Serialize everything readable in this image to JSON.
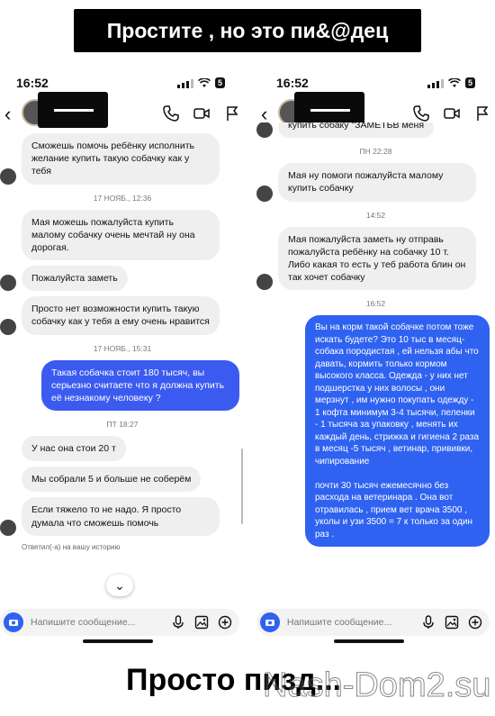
{
  "banner": {
    "text": "Простите , но это пи&@дец"
  },
  "caption": {
    "text": "Просто пизд..."
  },
  "watermark": {
    "text": "Nash-Dom2.su"
  },
  "left": {
    "status": {
      "time": "16:52",
      "battery": "5"
    },
    "messages": [
      {
        "type": "in",
        "text": "Сможешь помочь ребёнку исполнить желание купить такую собачку как у тебя"
      },
      {
        "type": "ts",
        "text": "17 НОЯБ., 12:36"
      },
      {
        "type": "in",
        "text": "Мая можешь пожалуйста купить малому собачку очень мечтай ну она дорогая."
      },
      {
        "type": "in",
        "text": "Пожалуйста заметь"
      },
      {
        "type": "in",
        "text": "Просто нет возможности купить такую собачку как у тебя а ему очень нравится"
      },
      {
        "type": "ts",
        "text": "17 НОЯБ., 15:31"
      },
      {
        "type": "out",
        "text": "Такая собачка стоит 180 тысяч, вы серьезно считаете что я должна купить её незнакому человеку ?"
      },
      {
        "type": "ts",
        "text": "ПТ 18:27"
      },
      {
        "type": "in",
        "text": "У нас она стои 20 т"
      },
      {
        "type": "in",
        "text": "Мы собрали 5 и больше не соберём"
      },
      {
        "type": "in",
        "text": "Если тяжело то не надо. Я просто думала что сможешь помочь"
      }
    ],
    "reply_note": "Ответил(-а) на вашу историю",
    "composer_placeholder": "Напишите сообщение..."
  },
  "right": {
    "status": {
      "time": "16:52",
      "battery": "5"
    },
    "messages": [
      {
        "type": "in",
        "text": "купить собаку \"ЗАМЕТЬВ меня"
      },
      {
        "type": "ts",
        "text": "ПН 22:28"
      },
      {
        "type": "in",
        "text": "Мая ну помоги пожалуйста малому купить собачку"
      },
      {
        "type": "ts",
        "text": "14:52"
      },
      {
        "type": "in",
        "text": "Мая пожалуйста заметь ну отправь пожалуйста ребёнку на собачку 10 т. Либо какая то есть у теб работа блин он так хочет собачку"
      },
      {
        "type": "ts",
        "text": "16:52"
      },
      {
        "type": "out",
        "text": "Вы на корм такой собачке потом тоже искать будете? Это 10 тыс в месяц- собака породистая , ей нельзя абы что давать, кормить только кормом высокого класса. Одежда - у них нет подшерстка у них волосы , они мерзнут , им нужно покупать одежду - 1 кофта минимум 3-4 тысячи, пеленки - 1  тысяча за упаковку , менять их каждый день, стрижка и гигиена 2 раза в месяц -5 тысяч  , ветинар, прививки, чипирование\n\n почти 30 тысяч ежемесячно без расхода на ветеринара . Она вот отравилась , прием вет врача 3500 , уколы и узи 3500 = 7 к только за один раз ."
      }
    ],
    "composer_placeholder": "Напишите сообщение..."
  }
}
